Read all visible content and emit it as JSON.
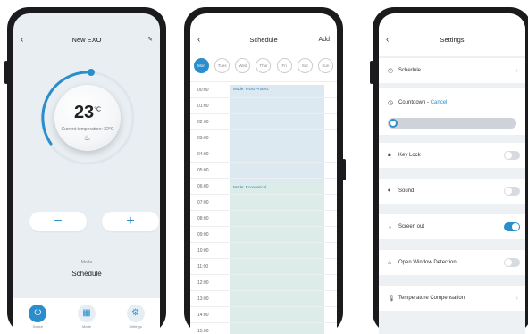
{
  "screen1": {
    "title": "New EXO",
    "temperature": "23",
    "temp_unit": "°C",
    "current_temp": "Current temperature: 22°C",
    "minus": "−",
    "plus": "+",
    "mode_label": "Mode",
    "mode_value": "Schedule",
    "tabs": [
      {
        "label": "Switch",
        "icon": "power-icon"
      },
      {
        "label": "Mode",
        "icon": "grid-icon"
      },
      {
        "label": "Settings",
        "icon": "gear-icon"
      }
    ],
    "accent": "#2b8ecc"
  },
  "screen2": {
    "title": "Schedule",
    "add": "Add",
    "days": [
      "Mon",
      "Tues",
      "Wed",
      "Thur",
      "Fri",
      "Sat",
      "Sun"
    ],
    "times": [
      "00:00",
      "01:00",
      "02:00",
      "03:00",
      "04:00",
      "05:00",
      "06:00",
      "07:00",
      "08:00",
      "09:00",
      "10:00",
      "11:00",
      "12:00",
      "13:00",
      "14:00",
      "15:00"
    ],
    "blocks": [
      {
        "label": "Mode: Frost Protect",
        "color": "#dde9f1"
      },
      {
        "label": "Mode: Economical",
        "color": "#dcece9"
      }
    ]
  },
  "screen3": {
    "title": "Settings",
    "schedule": "Schedule",
    "countdown": "Countdown - ",
    "cancel": "Cancel",
    "key_lock": "Key Lock",
    "sound": "Sound",
    "screen_out": "Screen out",
    "open_window": "Open Window Detection",
    "temp_comp": "Temperature Compensation"
  }
}
